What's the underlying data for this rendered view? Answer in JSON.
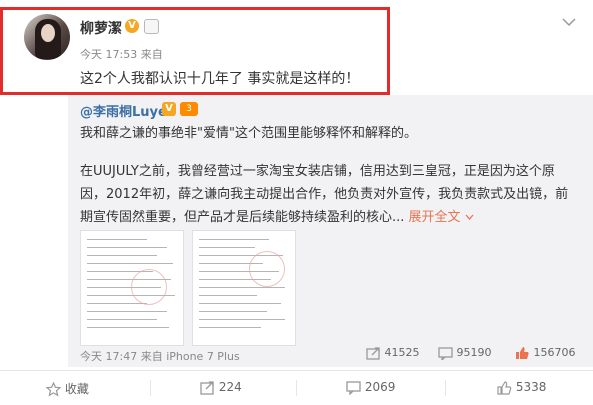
{
  "post": {
    "author": "柳萝潔",
    "meta": "今天 17:53 来自",
    "text": "这2个人我都认识十几年了 事实就是这样的！"
  },
  "repost": {
    "author": "@李雨桐Luyee",
    "badge_extra": "3",
    "line1": "我和薛之谦的事绝非\"爱情\"这个范围里能够释怀和解释的。",
    "paragraph": "在UUJULY之前，我曾经营过一家淘宝女装店铺，信用达到三皇冠，正是因为这个原因，2012年初，薛之谦向我主动提出合作，他负责对外宣传，我负责款式及出镜，前期宣传固然重要，但产品才是后续能够持续盈利的核心...",
    "expand_label": "展开全文",
    "expand_icon": "chevron-down-icon",
    "meta": "今天 17:47 来自 iPhone 7 Plus",
    "reposts": "41525",
    "comments": "95190",
    "likes": "156706"
  },
  "actions": {
    "favorite": "收藏",
    "reposts": "224",
    "comments": "2069",
    "likes": "5338"
  },
  "colors": {
    "highlight": "#e32b2b",
    "link": "#3b6fa5",
    "like": "#eb7350"
  }
}
